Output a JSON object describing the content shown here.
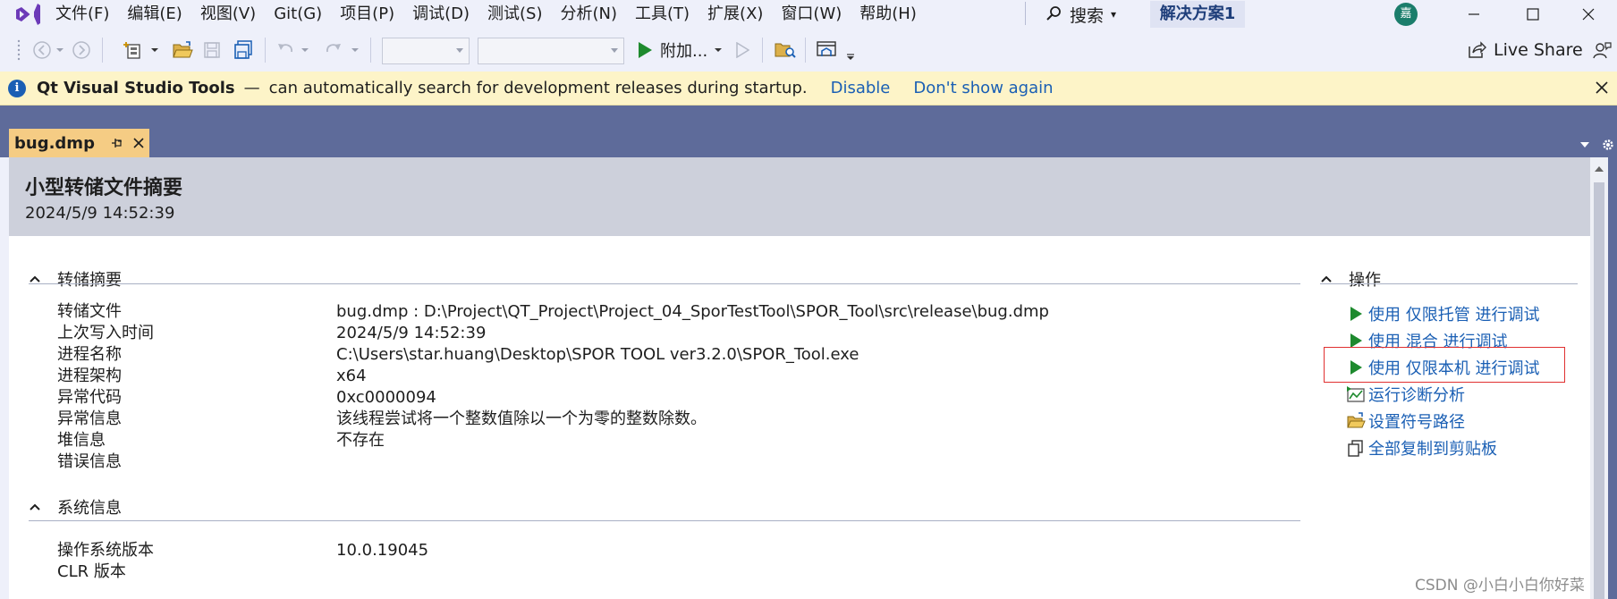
{
  "menu": {
    "items": [
      "文件(F)",
      "编辑(E)",
      "视图(V)",
      "Git(G)",
      "项目(P)",
      "调试(D)",
      "测试(S)",
      "分析(N)",
      "工具(T)",
      "扩展(X)",
      "窗口(W)",
      "帮助(H)"
    ],
    "search_label": "搜索",
    "solution_name": "解决方案1",
    "avatar_char": "嘉"
  },
  "toolbar": {
    "attach_label": "附加...",
    "live_share_label": "Live Share"
  },
  "infobar": {
    "title": "Qt Visual Studio Tools",
    "dash": "—",
    "message": "can automatically search for development releases during startup.",
    "link_disable": "Disable",
    "link_dont_show": "Don't show again"
  },
  "tab": {
    "name": "bug.dmp"
  },
  "header": {
    "title": "小型转储文件摘要",
    "datetime": "2024/5/9 14:52:39"
  },
  "dump_summary": {
    "heading": "转储摘要",
    "rows": [
      {
        "key": "转储文件",
        "value": "bug.dmp : D:\\Project\\QT_Project\\Project_04_SporTestTool\\SPOR_Tool\\src\\release\\bug.dmp"
      },
      {
        "key": "上次写入时间",
        "value": "2024/5/9 14:52:39"
      },
      {
        "key": "进程名称",
        "value": "C:\\Users\\star.huang\\Desktop\\SPOR TOOL ver3.2.0\\SPOR_Tool.exe"
      },
      {
        "key": "进程架构",
        "value": "x64"
      },
      {
        "key": "异常代码",
        "value": "0xc0000094"
      },
      {
        "key": "异常信息",
        "value": "该线程尝试将一个整数值除以一个为零的整数除数。"
      },
      {
        "key": "堆信息",
        "value": "不存在"
      },
      {
        "key": "错误信息",
        "value": ""
      }
    ]
  },
  "system_info": {
    "heading": "系统信息",
    "rows": [
      {
        "key": "操作系统版本",
        "value": "10.0.19045"
      },
      {
        "key": "CLR 版本",
        "value": ""
      }
    ]
  },
  "actions": {
    "heading": "操作",
    "items": [
      {
        "label": "使用 仅限托管 进行调试",
        "icon": "play-icon"
      },
      {
        "label": "使用 混合 进行调试",
        "icon": "play-icon"
      },
      {
        "label": "使用 仅限本机 进行调试",
        "icon": "play-icon"
      },
      {
        "label": "运行诊断分析",
        "icon": "diagnostics-icon"
      },
      {
        "label": "设置符号路径",
        "icon": "folder-open-icon"
      },
      {
        "label": "全部复制到剪贴板",
        "icon": "copy-icon"
      }
    ]
  },
  "watermark": "CSDN @小白小白你好菜",
  "colors": {
    "accent_link": "#1a5fb4",
    "tabstrip": "#5e6b9a",
    "active_tab": "#f5cc84",
    "infobar": "#fdf4c8",
    "play_green": "#1e8a2e",
    "highlight_red": "#e03030"
  }
}
